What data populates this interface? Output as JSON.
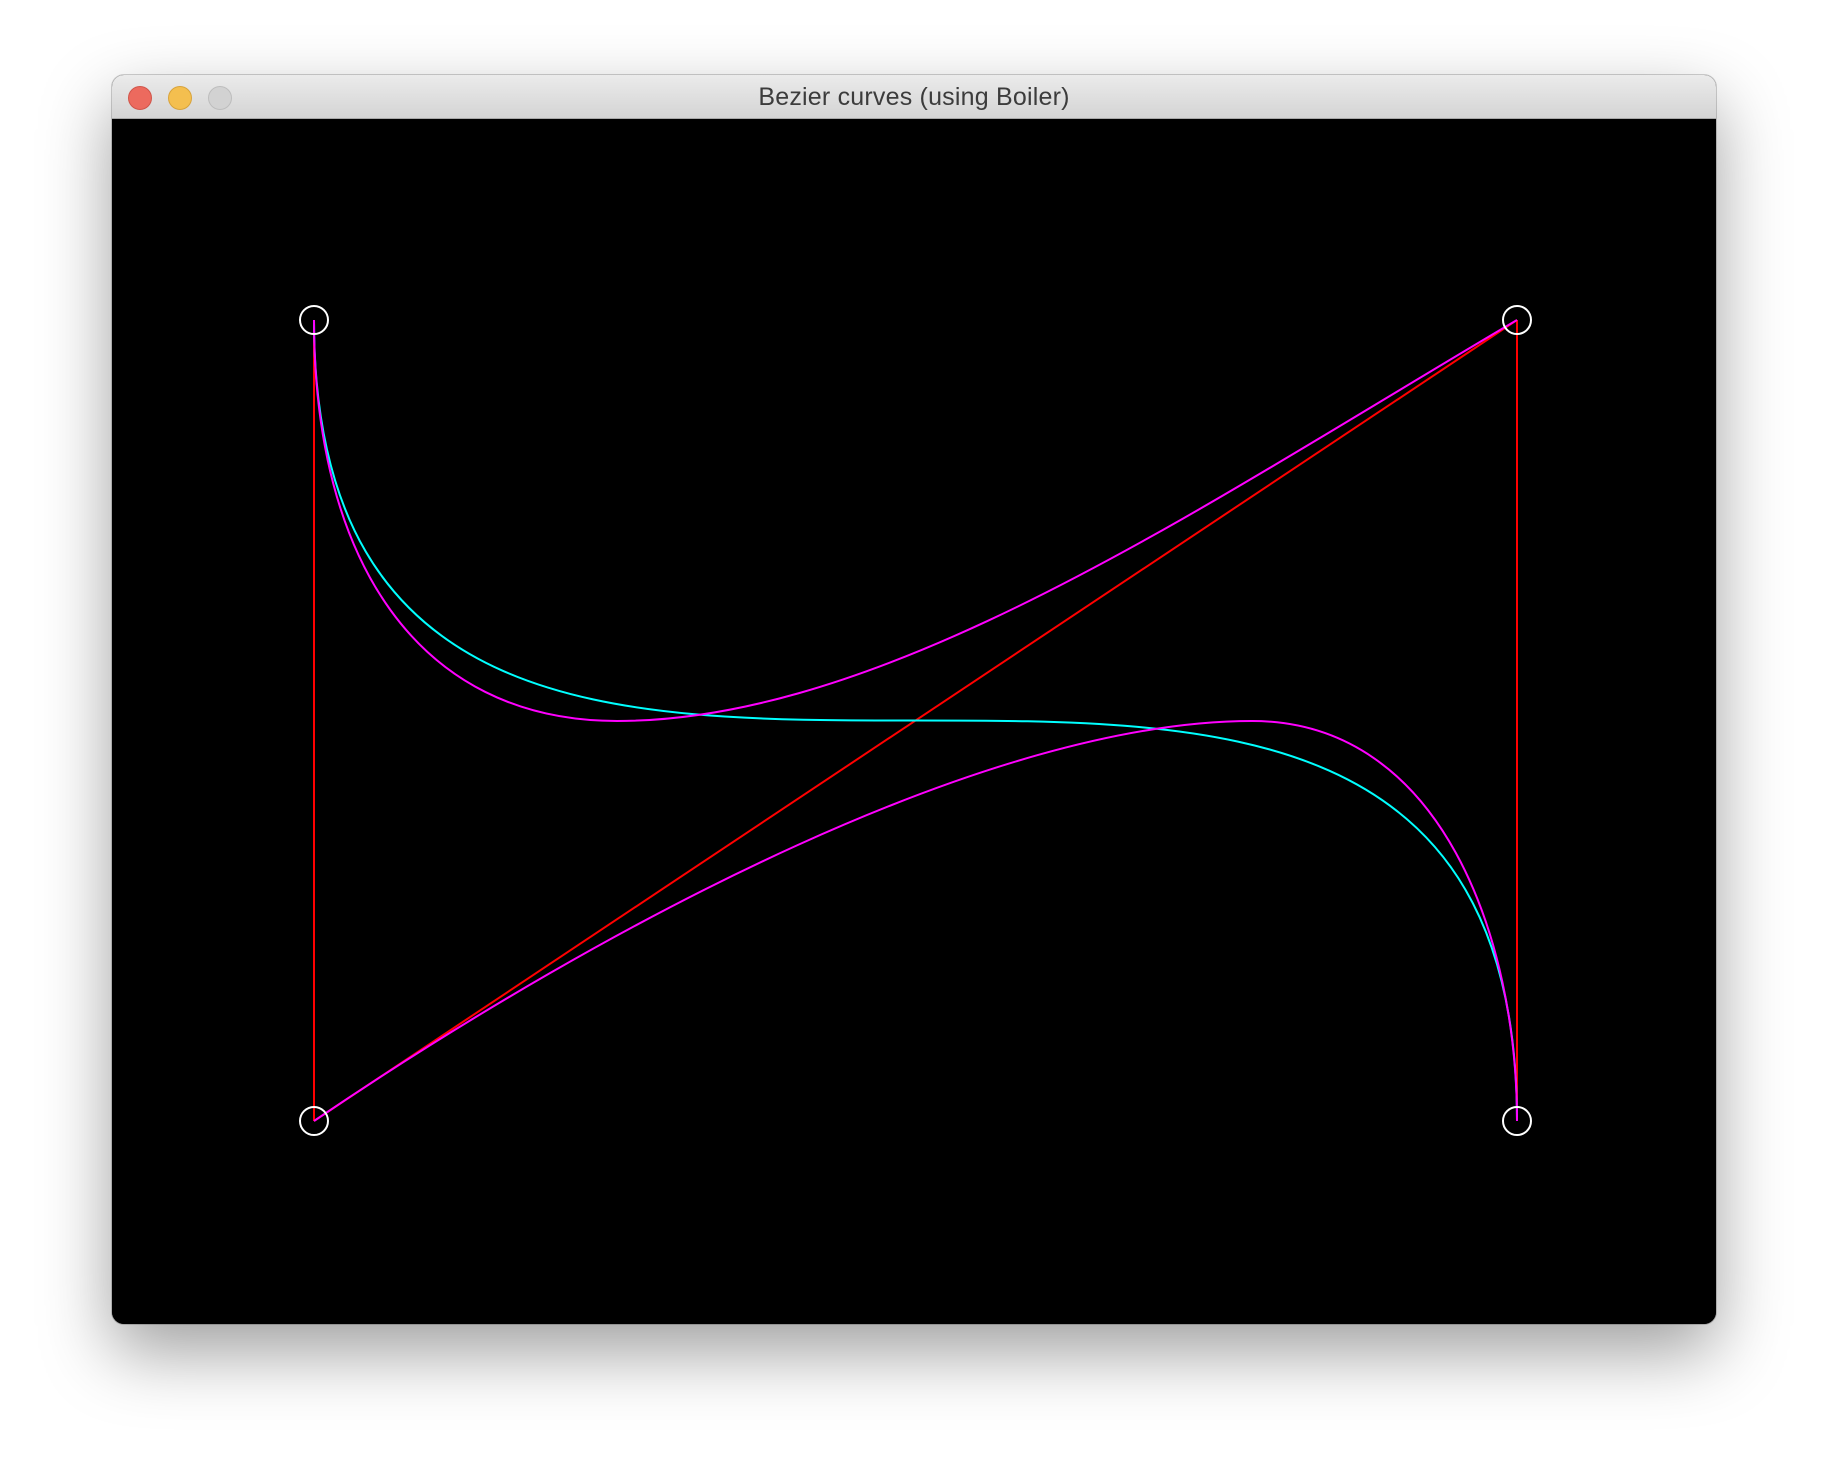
{
  "window": {
    "title": "Bezier curves (using Boiler)",
    "buttons": {
      "close": "close-button",
      "minimize": "minimize-button",
      "zoom": "zoom-button"
    }
  },
  "canvas": {
    "background": "#000000",
    "colors": {
      "control_polygon": "#ff0000",
      "curve_a": "#00ffff",
      "curve_b": "#ff00ff",
      "control_point": "#ffffff"
    }
  }
}
